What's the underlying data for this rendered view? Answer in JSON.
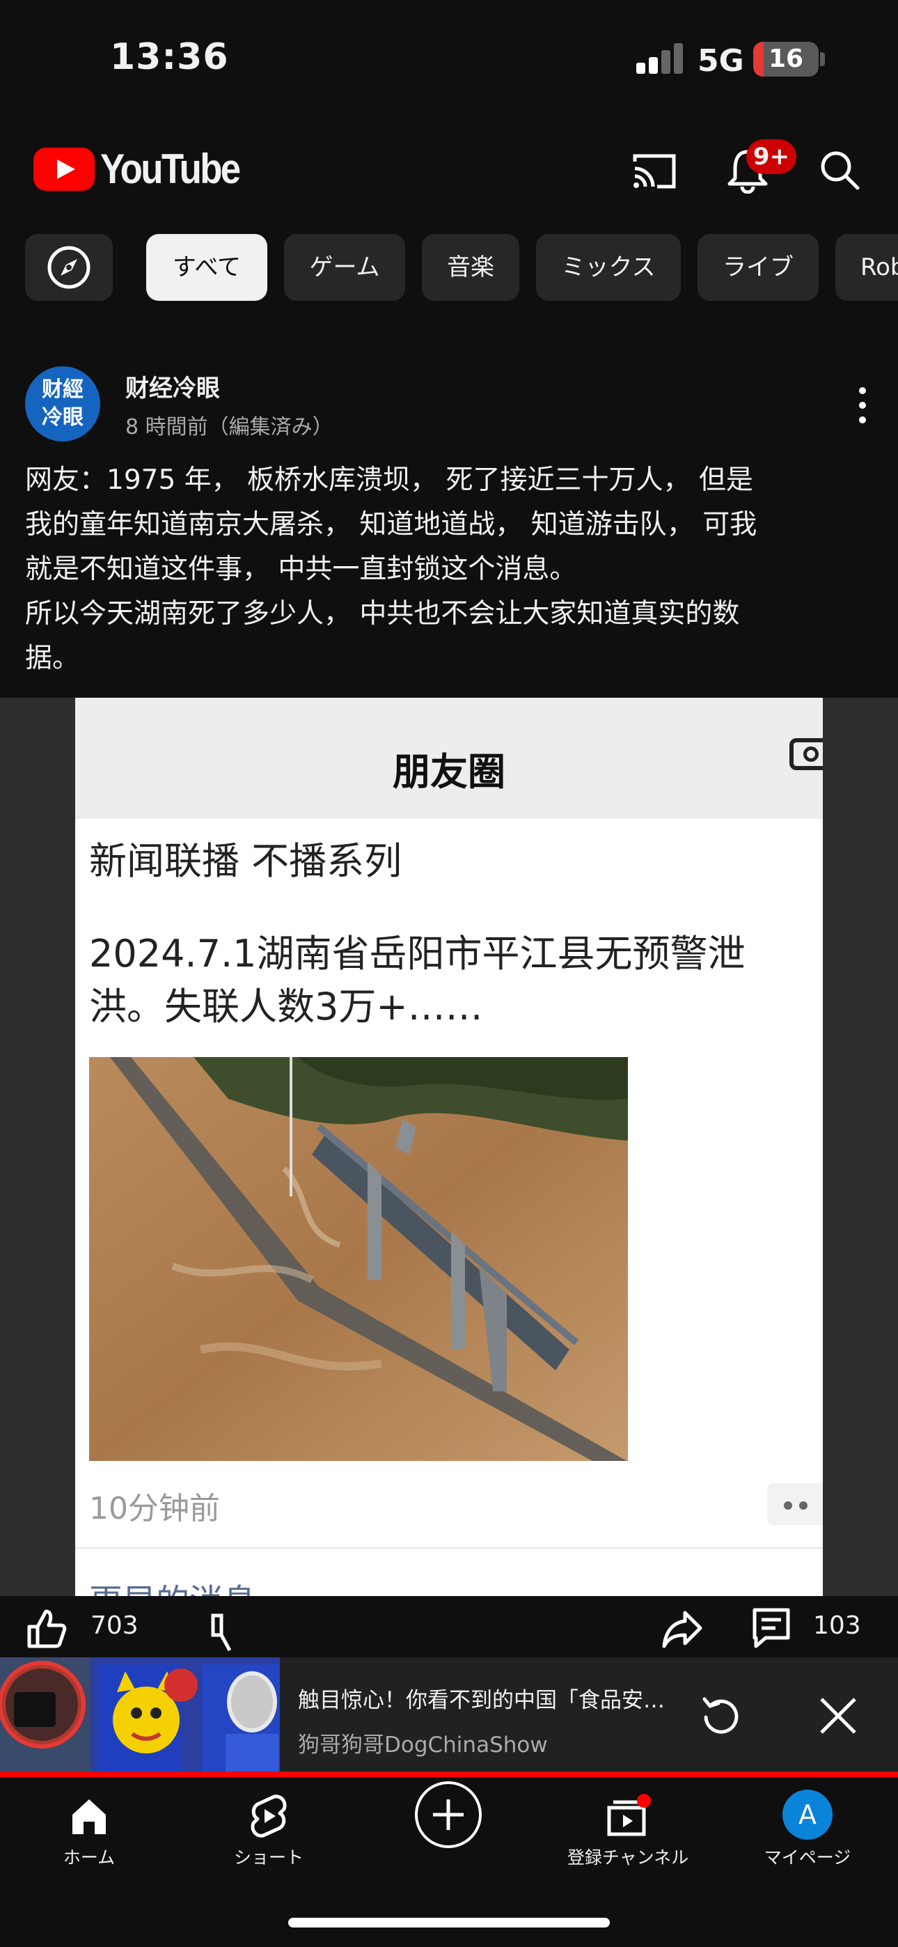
{
  "status_bar": {
    "time": "13:36",
    "network": "5G",
    "battery": "16"
  },
  "header": {
    "logo_text": "YouTube",
    "notification_badge": "9+"
  },
  "chips": [
    "すべて",
    "ゲーム",
    "音楽",
    "ミックス",
    "ライブ",
    "Rob"
  ],
  "post": {
    "channel_avatar_text": "财經\n冷眼",
    "channel_name": "财经冷眼",
    "meta": "8 時間前（編集済み）",
    "text": "网友：1975 年， 板桥水库溃坝， 死了接近三十万人， 但是\n我的童年知道南京大屠杀， 知道地道战， 知道游击队， 可我\n就是不知道这件事， 中共一直封锁这个消息。\n所以今天湖南死了多少人， 中共也不会让大家知道真实的数\n据。",
    "image": {
      "header_title": "朋友圈",
      "line1": "新闻联播 不播系列",
      "line2": "2024.7.1湖南省岳阳市平江县无预警泄洪。失联人数3万+……",
      "time": "10分钟前",
      "next_text": "更早的消息"
    },
    "likes": "703",
    "comments": "103"
  },
  "miniplayer": {
    "title": "触目惊心！你看不到的中国「食品安全」",
    "channel": "狗哥狗哥DogChinaShow"
  },
  "nav": {
    "home": "ホーム",
    "shorts": "ショート",
    "subscriptions": "登録チャンネル",
    "you": "マイページ",
    "avatar_letter": "A"
  },
  "colors": {
    "brand_red": "#ff0000",
    "background": "#0f0f0f",
    "chip": "#272727",
    "avatar_blue": "#1565c0"
  }
}
